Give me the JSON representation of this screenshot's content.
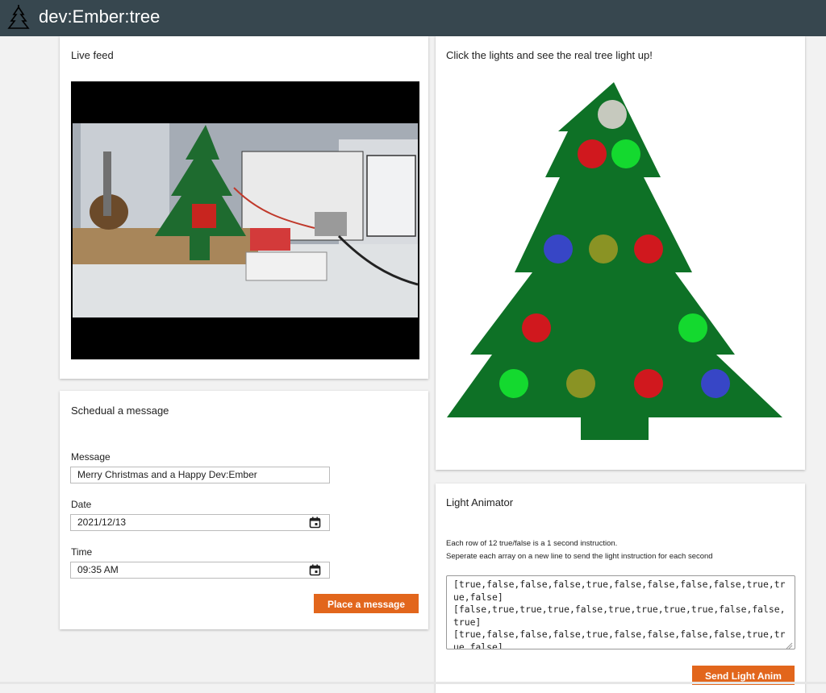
{
  "app": {
    "title": "dev:Ember:tree",
    "logo_icon": "christmas-tree-icon"
  },
  "live_feed": {
    "title": "Live feed"
  },
  "schedule": {
    "title": "Schedual a message",
    "message_label": "Message",
    "message_value": "Merry Christmas and a Happy Dev:Ember",
    "date_label": "Date",
    "date_value": "2021/12/13",
    "time_label": "Time",
    "time_value": "09:35 AM",
    "submit_label": "Place a message"
  },
  "tree_panel": {
    "title": "Click the lights and see the real tree light up!",
    "tree_color": "#0e7126",
    "lights": [
      {
        "color": "#c6c9be"
      },
      {
        "color": "#d0181e"
      },
      {
        "color": "#14d92f"
      },
      {
        "color": "#3746c6"
      },
      {
        "color": "#8a9324"
      },
      {
        "color": "#d0181e"
      },
      {
        "color": "#d0181e"
      },
      {
        "color": "#14d92f"
      },
      {
        "color": "#14d92f"
      },
      {
        "color": "#8a9324"
      },
      {
        "color": "#d0181e"
      },
      {
        "color": "#3746c6"
      }
    ]
  },
  "animator": {
    "title": "Light Animator",
    "help_line1": "Each row of 12 true/false is a 1 second instruction.",
    "help_line2": "Seperate each array on a new line to send the light instruction for each second",
    "instructions": "[true,false,false,false,true,false,false,false,false,true,true,false]\n[false,true,true,true,false,true,true,true,true,false,false,true]\n[true,false,false,false,true,false,false,false,false,true,true,false]",
    "send_label": "Send Light Anim"
  },
  "colors": {
    "header": "#37474f",
    "accent": "#e2661c"
  }
}
